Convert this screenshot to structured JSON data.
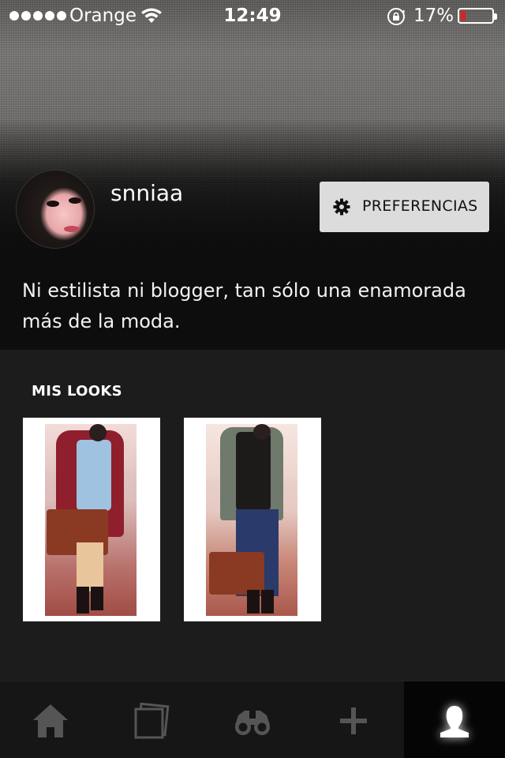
{
  "status_bar": {
    "carrier": "Orange",
    "time": "12:49",
    "battery_percent": "17%",
    "battery_level": 0.17,
    "signal_icon": "signal-dots-icon",
    "wifi_icon": "wifi-icon",
    "rotation_lock_icon": "rotation-lock-icon"
  },
  "profile": {
    "username": "snniaa",
    "bio": "Ni estilista ni blogger, tan sólo una enamorada más de la moda.",
    "preferences_button": {
      "label": "PREFERENCIAS",
      "icon": "gear-icon"
    }
  },
  "looks": {
    "title": "MIS LOOKS",
    "items": [
      {
        "name": "look-1"
      },
      {
        "name": "look-2"
      }
    ]
  },
  "tabbar": {
    "active": "profile",
    "tabs": [
      {
        "id": "home",
        "icon": "home-icon"
      },
      {
        "id": "looks",
        "icon": "cards-icon"
      },
      {
        "id": "explore",
        "icon": "binoculars-icon"
      },
      {
        "id": "add",
        "icon": "plus-icon"
      },
      {
        "id": "profile",
        "icon": "user-icon"
      }
    ]
  },
  "colors": {
    "battery_low": "#e02020",
    "button_bg": "#dcdcdc",
    "background": "#1c1c1c"
  }
}
